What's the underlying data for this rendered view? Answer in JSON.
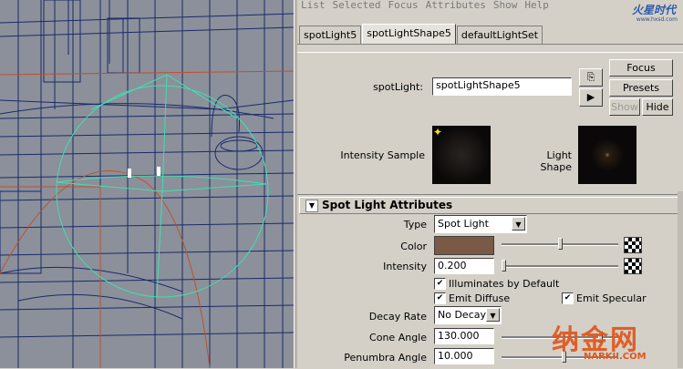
{
  "menu": [
    "List",
    "Selected",
    "Focus",
    "Attributes",
    "Show",
    "Help"
  ],
  "logo_top": "火星时代",
  "logo_sub": "www.hxsd.com",
  "tabs": [
    "spotLight5",
    "spotLightShape5",
    "defaultLightSet"
  ],
  "active_tab": 1,
  "node": {
    "label": "spotLight:",
    "value": "spotLightShape5",
    "focus": "Focus",
    "presets": "Presets",
    "show": "Show",
    "hide": "Hide",
    "intensity_sample": "Intensity Sample",
    "light_shape": "Light Shape"
  },
  "section": {
    "title": "Spot Light Attributes",
    "type_label": "Type",
    "type_value": "Spot Light",
    "color_label": "Color",
    "color_value": "#7a5a45",
    "intensity_label": "Intensity",
    "intensity_value": "0.200",
    "illuminates": "Illuminates by Default",
    "emit_diffuse": "Emit Diffuse",
    "emit_specular": "Emit Specular",
    "decay_label": "Decay Rate",
    "decay_value": "No Decay",
    "cone_label": "Cone Angle",
    "cone_value": "130.000",
    "penumbra_label": "Penumbra Angle",
    "penumbra_value": "10.000"
  },
  "watermark": "纳金网",
  "watermark_sub": "NARKII.COM",
  "icons": [
    "connect-icon",
    "map-icon",
    "checker-map-icon",
    "collapse-triangle-icon",
    "checkmark-icon",
    "dropdown-arrow-icon"
  ]
}
